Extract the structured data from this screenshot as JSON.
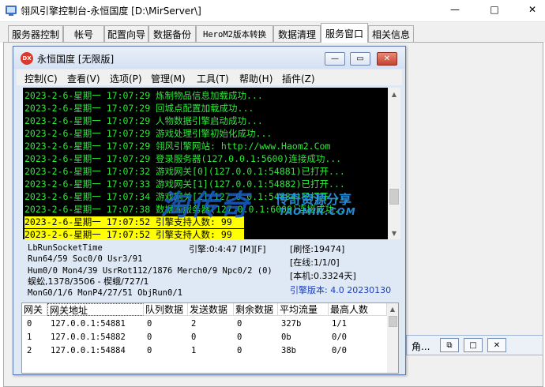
{
  "outer": {
    "title": "翎风引擎控制台-永恒国度 [D:\\MirServer\\]",
    "tabs": [
      {
        "label": "服务器控制"
      },
      {
        "label": "帐号"
      },
      {
        "label": "配置向导"
      },
      {
        "label": "数据备份"
      },
      {
        "label": "HeroM2版本转换"
      },
      {
        "label": "数据清理"
      },
      {
        "label": "服务窗口"
      },
      {
        "label": "相关信息"
      }
    ],
    "active_tab": "服务窗口",
    "minimize_symbol": "—",
    "maximize_symbol": "□",
    "close_symbol": "✕"
  },
  "minimized_window": {
    "label": "角..."
  },
  "inner": {
    "icon_text": "DX",
    "title": "永恒国度 [无限版]",
    "menu": [
      {
        "label": "控制(C)"
      },
      {
        "label": "查看(V)"
      },
      {
        "label": "选项(P)"
      },
      {
        "label": "管理(M)"
      },
      {
        "label": "工具(T)"
      },
      {
        "label": "帮助(H)"
      },
      {
        "label": "插件(Z)"
      }
    ]
  },
  "log": {
    "lines": [
      {
        "text": "2023-2-6-星期一 17:07:29 炼制物品信息加载成功..."
      },
      {
        "text": "2023-2-6-星期一 17:07:29 回城点配置加载成功..."
      },
      {
        "text": "2023-2-6-星期一 17:07:29 人物数据引擎启动成功..."
      },
      {
        "text": "2023-2-6-星期一 17:07:29 游戏处理引擎初始化成功..."
      },
      {
        "text": "2023-2-6-星期一 17:07:29 翎风引擎网站: http://www.Haom2.Com"
      },
      {
        "text": "2023-2-6-星期一 17:07:29 登录服务器(127.0.0.1:5600)连接成功..."
      },
      {
        "text": "2023-2-6-星期一 17:07:32 游戏网关[0](127.0.0.1:54881)已打开..."
      },
      {
        "text": "2023-2-6-星期一 17:07:33 游戏网关[1](127.0.0.1:54882)已打开..."
      },
      {
        "text": "2023-2-6-星期一 17:07:34 游戏网关[2](127.0.0.1:54884)已打开..."
      },
      {
        "text": "2023-2-6-星期一 17:07:38 数据库服务器(127.0.0.1:6000)连接成功..."
      },
      {
        "text": "2023-2-6-星期一 17:07:52 引擎支持人数: 99"
      },
      {
        "text": "2023-2-6-星期一 17:07:52 引擎支持人数: 99"
      }
    ],
    "highlighted_count": 2
  },
  "watermark": {
    "big": "淘传奇",
    "cn": "传奇资源分享",
    "url": "TAOMIR.COM"
  },
  "stats": {
    "run_socket_time": "LbRunSocketTime",
    "engine_time": "引擎:0:4:47 [M][F]",
    "refresh": "[刷怪:19474]",
    "run_line": "Run64/59 Soc0/0 Usr3/91",
    "online": "[在线:1/1/0]",
    "hum_line": "Hum0/0 Mon4/39 UsrRot112/1876 Merch0/9 Npc0/2 (0)",
    "local": "[本机:0.3324天]",
    "monster_line": "蜈蚣,1378/3506 - 楔蛾/727/1",
    "version": "引擎版本: 4.0 20230130",
    "mon_line": "MonG0/1/6 MonP4/27/51 ObjRun0/1"
  },
  "gateway": {
    "headers": [
      "网关",
      "网关地址",
      "队列数据",
      "发送数据",
      "剩余数据",
      "平均流量",
      "最高人数"
    ],
    "rows": [
      [
        "0",
        "127.0.0.1:54881",
        "0",
        "2",
        "0",
        "327b",
        "1/1"
      ],
      [
        "1",
        "127.0.0.1:54882",
        "0",
        "0",
        "0",
        "0b",
        "0/0"
      ],
      [
        "2",
        "127.0.0.1:54884",
        "0",
        "1",
        "0",
        "38b",
        "0/0"
      ]
    ]
  },
  "colors": {
    "log_text": "#2de83a",
    "log_bg": "#000000",
    "highlight": "#ffff00",
    "version_text": "#1b3fb7",
    "inner_border": "#5c7ab0"
  }
}
